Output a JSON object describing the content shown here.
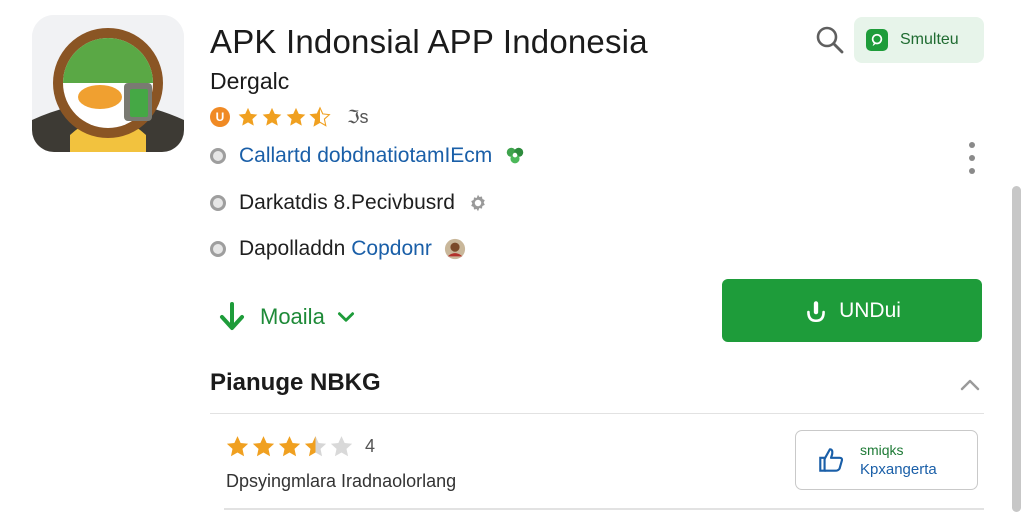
{
  "app": {
    "title": "APK Indonsial APP Indonesia",
    "subtitle": "Dergalc",
    "badge": "U",
    "rating_stars": 3.5,
    "rating_count": "ℑs"
  },
  "header": {
    "search_icon": "search-icon",
    "chat_button_label": "Smulteu",
    "more_icon": "more-vert-icon"
  },
  "info_rows": [
    {
      "text": "Callartd dobdnatiotamIEcm",
      "icon": "leaf-icon"
    },
    {
      "text": "Darkatdis 8.Pecivbusrd",
      "icon": "gear-icon"
    },
    {
      "prefix": "Dapolladdn",
      "link": "Copdonr",
      "icon": "avatar-icon"
    }
  ],
  "version_selector": {
    "label": "Moaila"
  },
  "download_button": {
    "label": "UNDui"
  },
  "section": {
    "title": "Pianuge NBKG"
  },
  "review": {
    "stars": 3.5,
    "count": "4",
    "text": "Dpsyingmlara Iradnaolorlang"
  },
  "like_button": {
    "line1": "smiqks",
    "line2": "Kpxangerta"
  },
  "colors": {
    "accent_green": "#1e9c3a",
    "link_blue": "#1a5fa8",
    "star_orange": "#f0a020",
    "badge_orange": "#f08a24"
  }
}
